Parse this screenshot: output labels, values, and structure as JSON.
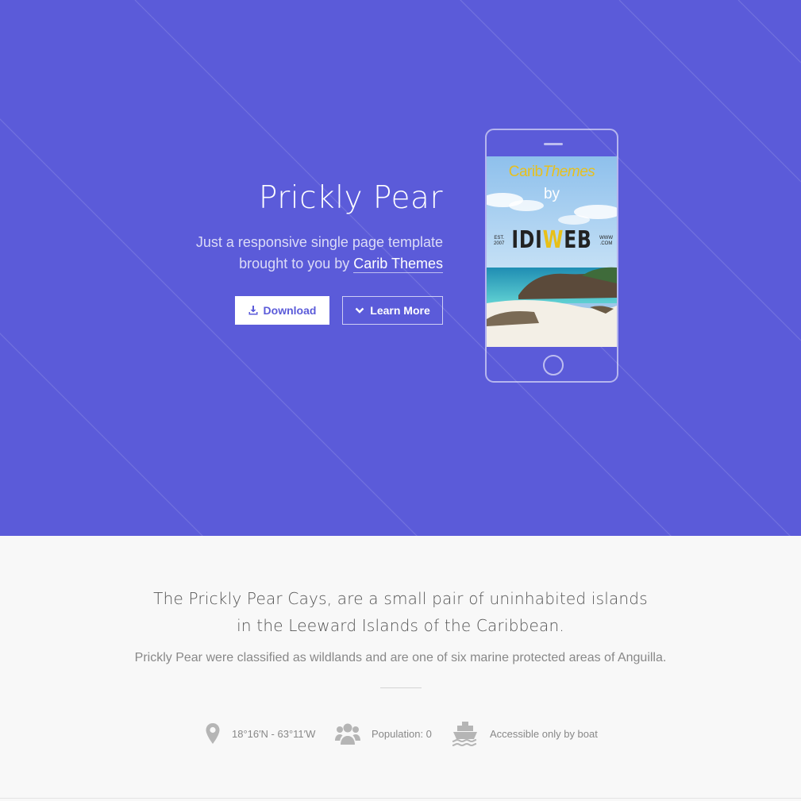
{
  "hero": {
    "title": "Prickly Pear",
    "subtitle_line1": "Just a responsive single page template",
    "subtitle_line2_prefix": "brought to you by",
    "subtitle_link": "Carib Themes",
    "download_label": "Download",
    "learn_more_label": "Learn More",
    "accent_color": "#5b5bd9",
    "download_icon": "download-icon",
    "learn_more_icon": "chevron-down-icon"
  },
  "phone_screen": {
    "brand_carib": "Carib",
    "brand_themes": "Themes",
    "by": "by",
    "logo_left": "IDI",
    "logo_w": "W",
    "logo_right": "EB",
    "est_line1": "EST.",
    "est_line2": "2007",
    "www_line1": "WWW",
    "www_line2": ".COM"
  },
  "info": {
    "headline_line1": "The Prickly Pear Cays, are a small pair of uninhabited islands",
    "headline_line2": "in the Leeward Islands of the Caribbean.",
    "description": "Prickly Pear were classified as wildlands and are one of six marine protected areas of Anguilla.",
    "facts": [
      {
        "icon": "map-marker-icon",
        "label": "18°16′N - 63°11′W"
      },
      {
        "icon": "users-icon",
        "label": "Population: 0"
      },
      {
        "icon": "ship-icon",
        "label": "Accessible only by boat"
      }
    ]
  }
}
